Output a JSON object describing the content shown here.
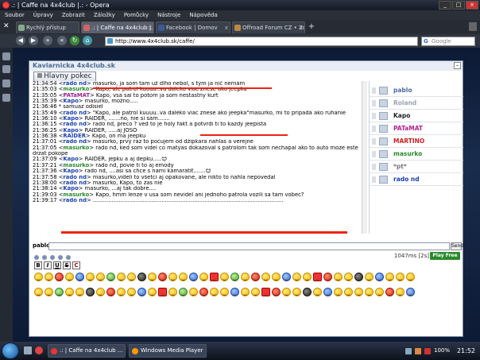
{
  "window": {
    "title": ".: | Caffe na 4x4club |.: - Opera"
  },
  "menu": [
    "Soubor",
    "Úpravy",
    "Zobrazit",
    "Záložky",
    "Pomůcky",
    "Nástroje",
    "Nápověda"
  ],
  "tabs": [
    {
      "label": "Rychlý přístup"
    },
    {
      "label": ".: | Caffe na 4x4club |...",
      "active": true
    },
    {
      "label": "Facebook | Domov"
    },
    {
      "label": "Offroad Forum CZ • Zob..."
    }
  ],
  "address": {
    "url": "http://www.4x4club.sk/caffe/",
    "search_placeholder": "Google"
  },
  "panel": {
    "title": "Kaviarnicka 4x4club.sk",
    "room_tab": "Hlavny pokec",
    "minimize": "–"
  },
  "messages": [
    {
      "time": "21:34:54",
      "nick": "rado nd",
      "color": "#1a3fae",
      "text": "masurko, ja som tam už dlho nebol, s tým ja nič nemám"
    },
    {
      "time": "21:35:03",
      "nick": "masurko",
      "color": "#2a8a2a",
      "text": "Kapo, ale patrol kuuuu..va daleko viac znese ako jeepka"
    },
    {
      "time": "21:35:05",
      "nick": "PATaMAT",
      "color": "#a0228a",
      "text": "Kapo, vsa sai to potom ja som nestastny kurt"
    },
    {
      "time": "21:35:39",
      "nick": "Kapo",
      "color": "#1a3fae",
      "text": "masurko, možno....."
    },
    {
      "time": "21:36:46",
      "nick": "",
      "color": "#000",
      "text": "* samuaz odisiel"
    },
    {
      "time": "21:35:49",
      "nick": "rado nd",
      "color": "#1a3fae",
      "text": "\"Kapo, ale patrol kuuuu..va daleko viac znese ako jeepka\"masurko, mi to pripadá ako rúhanie"
    },
    {
      "time": "21:36:10",
      "nick": "Kapo",
      "color": "#1a3fae",
      "text": "RAIDER, .......no, nie si sám......."
    },
    {
      "time": "21:36:15",
      "nick": "rado nd",
      "color": "#1a3fae",
      "text": "rado nd, preco ? ved to je holy fakt a potvrdi ti to kazdy jeepista"
    },
    {
      "time": "21:36:25",
      "nick": "Kapo",
      "color": "#1a3fae",
      "text": "RAIDER, .....aj JOSO"
    },
    {
      "time": "21:36:38",
      "nick": "RAIDER",
      "color": "#1a3fae",
      "text": "Kapo, on ma jeepku"
    },
    {
      "time": "21:37:01",
      "nick": "rado nd",
      "color": "#1a3fae",
      "text": "masurko, prvý raz to počujem od džípkara nahlas a verejne"
    },
    {
      "time": "21:37:05",
      "nick": "masurko",
      "color": "#2a8a2a",
      "text": "rado nd, ked som videl co matyas dokazoval s patrolom tak som nechapal ako to auto moze este"
    },
    {
      "time": "",
      "nick": "",
      "color": "#000",
      "text": "drzat pokope"
    },
    {
      "time": "21:37:09",
      "nick": "Kapo",
      "color": "#1a3fae",
      "text": "RAIDER, jepku a aj depku.....😊"
    },
    {
      "time": "21:37:21",
      "nick": "masurko",
      "color": "#2a8a2a",
      "text": "rado nd, povie ti to aj emody"
    },
    {
      "time": "21:37:36",
      "nick": "Kapo",
      "color": "#1a3fae",
      "text": "rado nd, ....asi sa chce s nami kamarátiť.......😊"
    },
    {
      "time": "21:37:58",
      "nick": "rado nd",
      "color": "#1a3fae",
      "text": "masurko,videli to všetci aj opakovane, ale nikto to nahla nepovedal"
    },
    {
      "time": "21:38:00",
      "nick": "rado nd",
      "color": "#1a3fae",
      "text": "masurko, Kapo, to zas nie"
    },
    {
      "time": "21:38:14",
      "nick": "Kapo",
      "color": "#1a3fae",
      "text": "masurko, ...aj tak dobre...."
    },
    {
      "time": "21:39:03",
      "nick": "masurko",
      "color": "#2a8a2a",
      "text": "Kapo, hmm lenze v usa som nevidel ani jednoho patrola vozili sa tam vobec?"
    },
    {
      "time": "21:39:17",
      "nick": "rado nd",
      "color": "#1a3fae",
      "text": "..............................................................................................................."
    }
  ],
  "users": [
    {
      "name": "pablo",
      "color": "#4b6aa8"
    },
    {
      "name": "Roland",
      "color": "#9aa3b2"
    },
    {
      "name": "Kapo",
      "color": "#222222"
    },
    {
      "name": "PATaMAT",
      "color": "#b4228f"
    },
    {
      "name": "MARTINO",
      "color": "#d02020"
    },
    {
      "name": "masurko",
      "color": "#2a8a2a"
    },
    {
      "name": "*pt*",
      "color": "#777777"
    },
    {
      "name": "rado nd",
      "color": "#1a3fae"
    }
  ],
  "input": {
    "label": "pablo:",
    "send": "Send"
  },
  "stats": "1047ms [2s]",
  "play_button": "Play Free Chat",
  "format_buttons": [
    "B",
    "I",
    "U",
    "S",
    "C"
  ],
  "taskbar": {
    "items": [
      {
        "label": ".: | Caffe na 4x4club ...",
        "icon": "opera-icon"
      },
      {
        "label": "Windows Media Player",
        "icon": "wmp-icon"
      }
    ],
    "zoom": "100%",
    "clock": "21:52"
  }
}
